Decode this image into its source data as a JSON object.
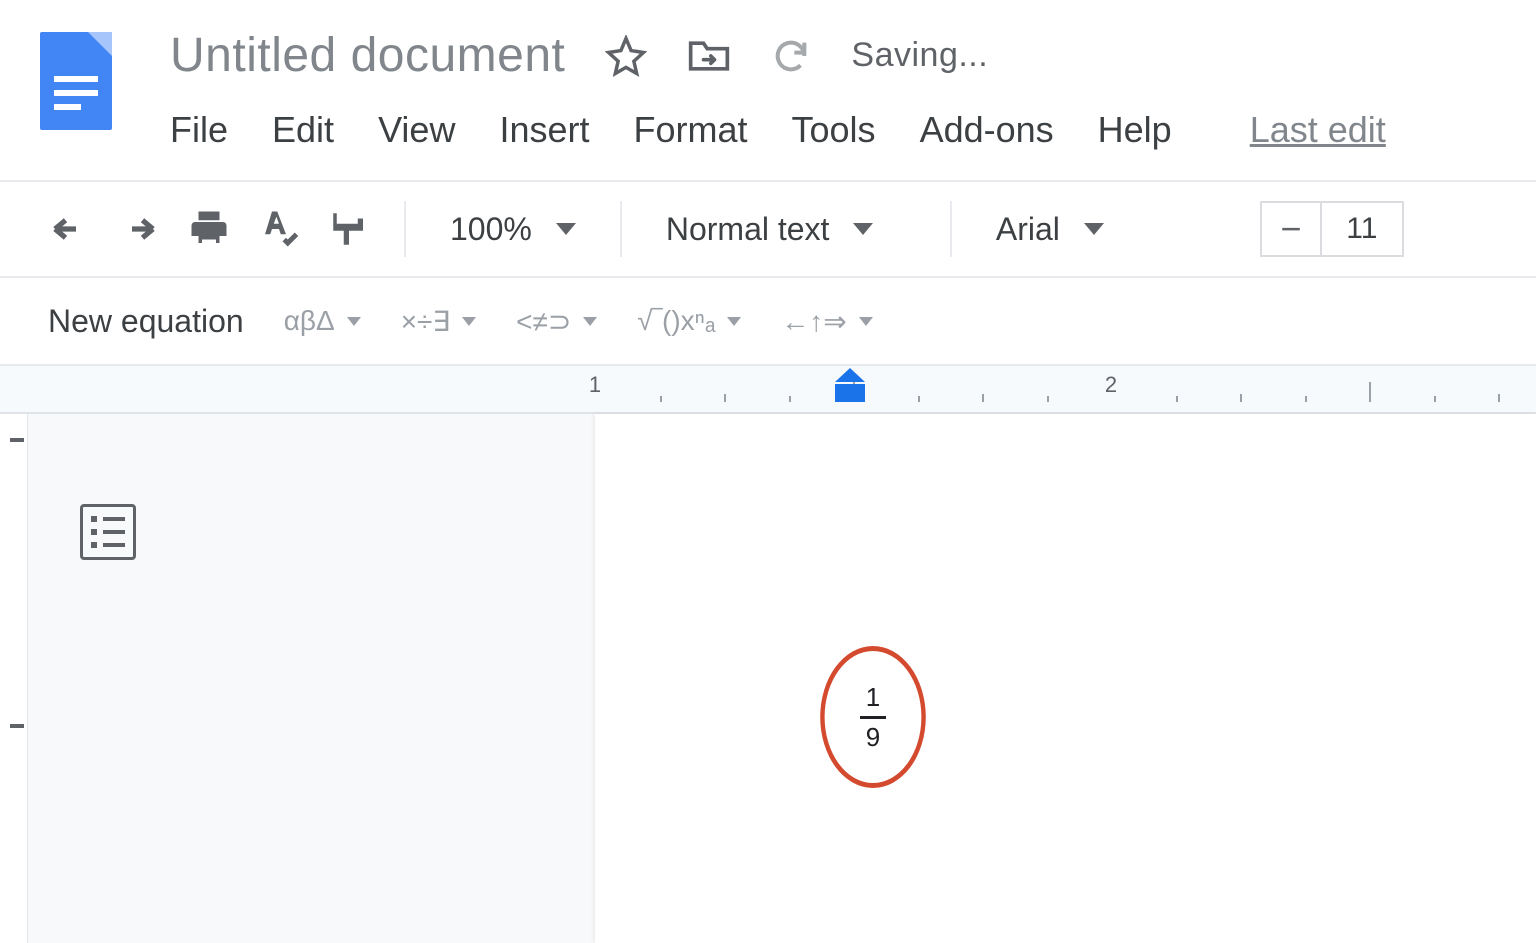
{
  "header": {
    "title": "Untitled document",
    "saving_text": "Saving...",
    "last_edit_text": "Last edit"
  },
  "menu": {
    "items": [
      "File",
      "Edit",
      "View",
      "Insert",
      "Format",
      "Tools",
      "Add-ons",
      "Help"
    ]
  },
  "toolbar": {
    "zoom": "100%",
    "paragraph_style": "Normal text",
    "font_family": "Arial",
    "font_size": "11"
  },
  "equation_bar": {
    "new_equation_label": "New equation",
    "groups": [
      "αβΔ",
      "×÷∃",
      "<≠⊃",
      "√‾()xⁿₐ",
      "←↑⇒"
    ]
  },
  "ruler": {
    "labels": [
      "1",
      "2"
    ]
  },
  "document": {
    "fraction": {
      "numerator": "1",
      "denominator": "9"
    }
  }
}
